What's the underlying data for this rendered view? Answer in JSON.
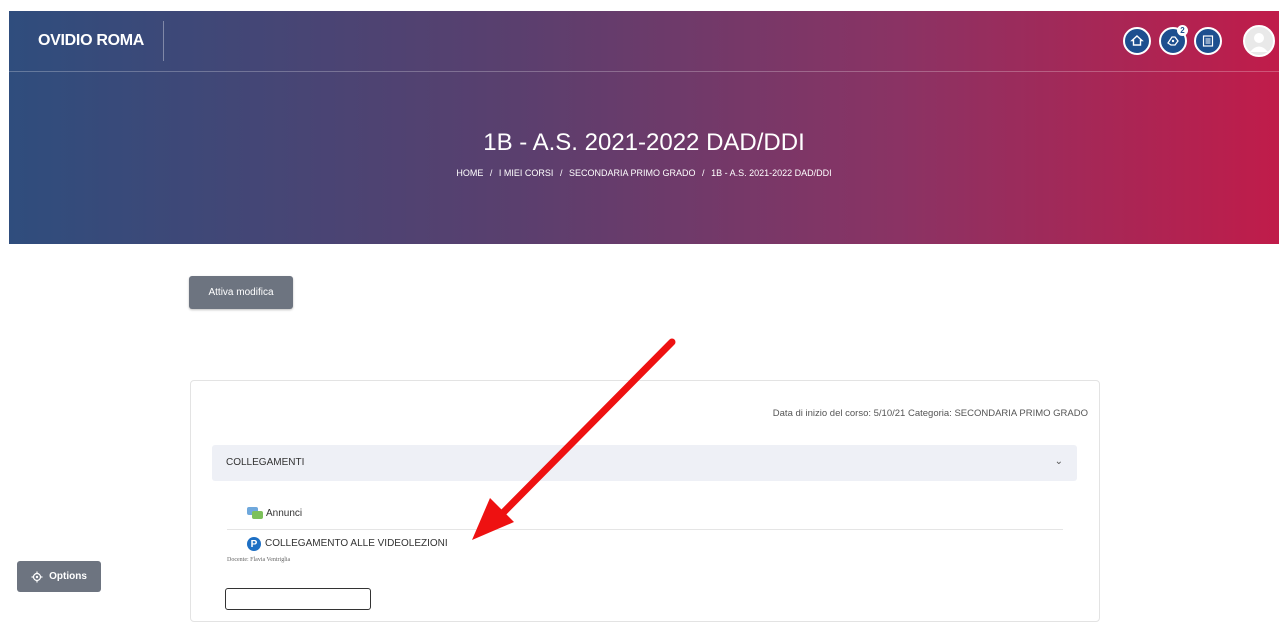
{
  "header": {
    "brand": "OVIDIO ROMA",
    "icons": [
      "italy-flag-icon",
      "home-icon",
      "messages-icon",
      "menu-list-icon",
      "user-avatar-icon"
    ],
    "messages_badge": "2"
  },
  "hero": {
    "title": "1B - A.S. 2021-2022 DAD/DDI",
    "breadcrumb": [
      "HOME",
      "I MIEI CORSI",
      "SECONDARIA PRIMO GRADO",
      "1B - A.S. 2021-2022 DAD/DDI"
    ],
    "breadcrumb_separator": "/"
  },
  "toolbar": {
    "edit_label": "Attiva modifica"
  },
  "course": {
    "info": "Data di inizio del corso: 5/10/21   Categoria: SECONDARIA PRIMO GRADO",
    "section_title": "COLLEGAMENTI",
    "activities": [
      {
        "label": "Annunci",
        "icon": "forum-icon"
      },
      {
        "label": "COLLEGAMENTO ALLE VIDEOLEZIONI",
        "icon": "p-icon",
        "description": "Docente: Flavia Ventriglia"
      }
    ]
  },
  "footer": {
    "options_label": "Options"
  },
  "colors": {
    "gradient_start": "#2f4d7d",
    "gradient_end": "#c01c4a",
    "button_grey": "#6d7480",
    "icon_blue": "#1d4f8f",
    "arrow_red": "#ee1111"
  }
}
